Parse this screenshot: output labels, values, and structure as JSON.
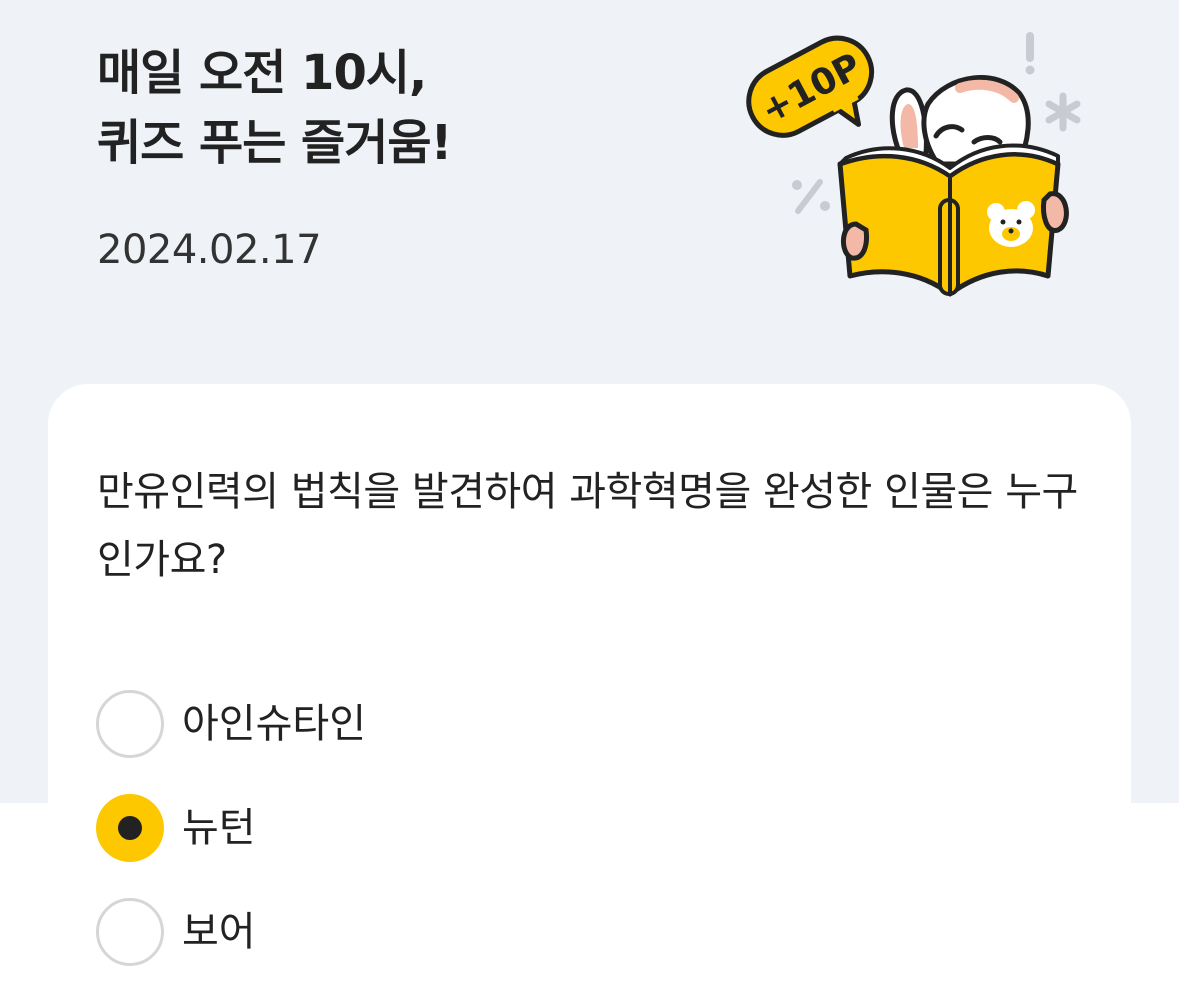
{
  "header": {
    "title_line1": "매일 오전 10시,",
    "title_line2": "퀴즈 푸는 즐거움!",
    "date": "2024.02.17",
    "badge_points": "+10P"
  },
  "quiz": {
    "question": "만유인력의 법칙을 발견하여 과학혁명을 완성한 인물은 누구인가요?",
    "options": [
      {
        "label": "아인슈타인",
        "selected": false
      },
      {
        "label": "뉴턴",
        "selected": true
      },
      {
        "label": "보어",
        "selected": false
      }
    ]
  },
  "colors": {
    "background": "#eff2f7",
    "accent_yellow": "#fdc800",
    "text": "#222222",
    "radio_border": "#d6d6d6"
  }
}
